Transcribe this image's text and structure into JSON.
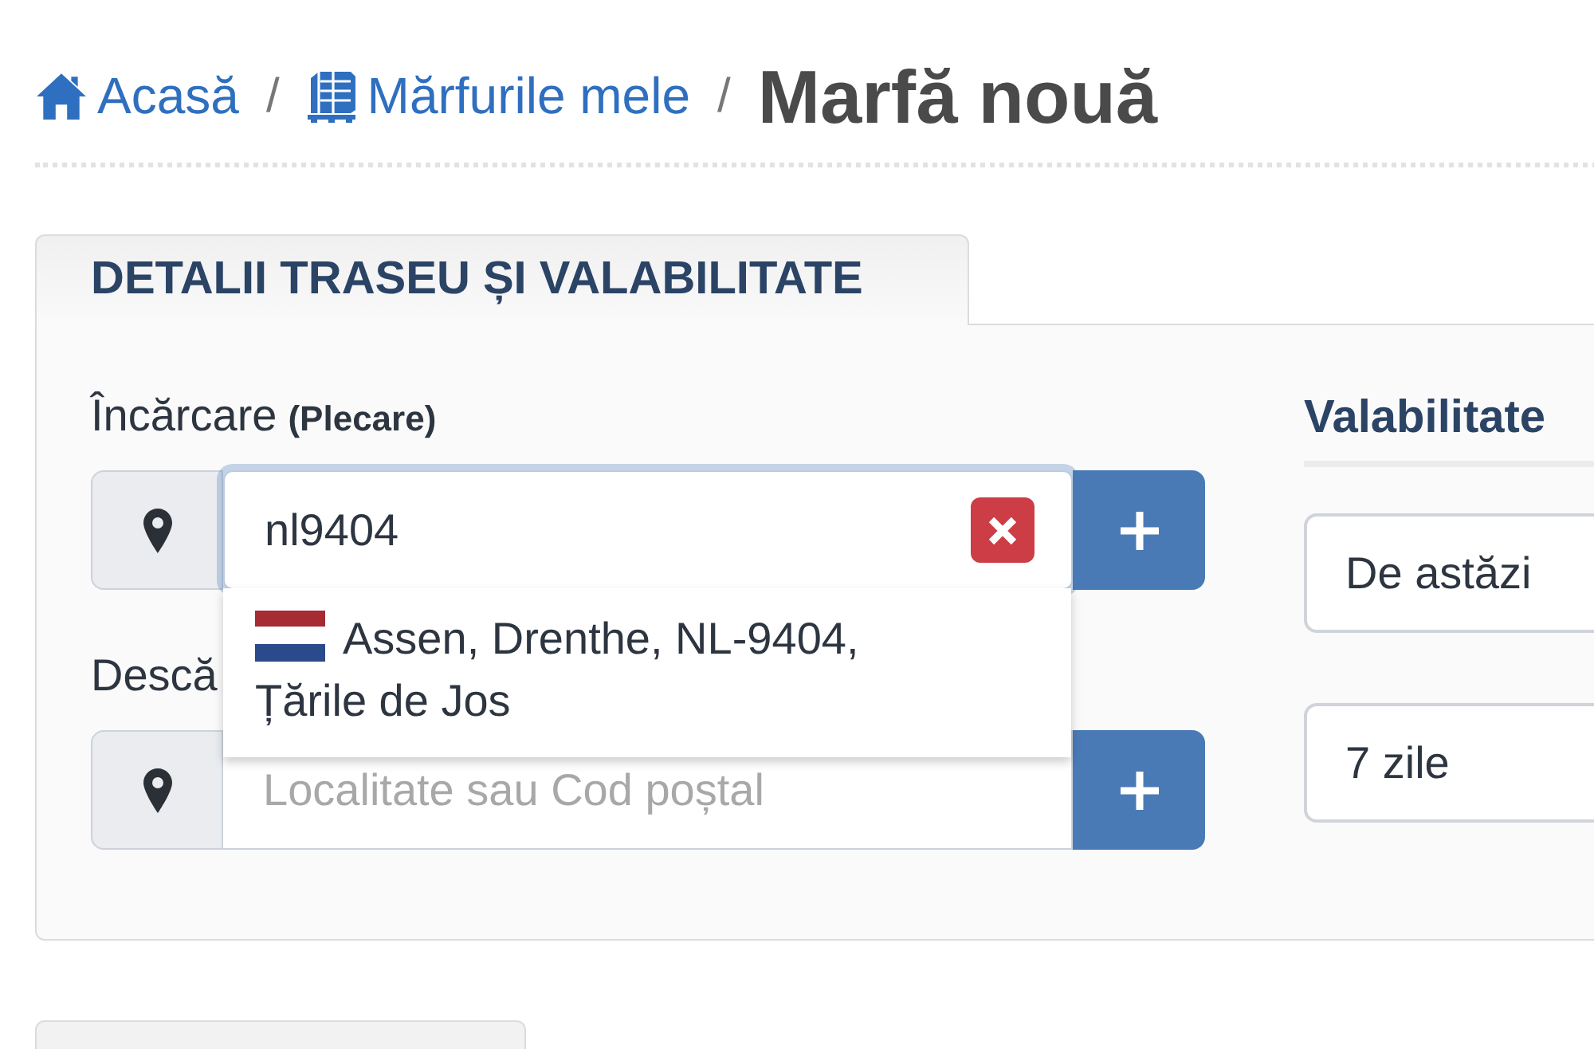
{
  "breadcrumb": {
    "links": [
      {
        "kind": "home",
        "label": "Acasă",
        "separator": "/"
      },
      {
        "kind": "goods",
        "label": "Mărfurile mele",
        "separator": "/"
      }
    ],
    "current": "Marfă nouă"
  },
  "panel": {
    "tab": "DETALII TRASEU ȘI VALABILITATE",
    "route": [
      {
        "label": "Încărcare",
        "note": "(Plecare)",
        "value": "nl9404",
        "focused": true,
        "suggestions": [
          {
            "text": "Assen, Drenthe, NL-9404, Țările de Jos"
          }
        ]
      },
      {
        "label": "Descă",
        "placeholder": "Localitate sau Cod poștal",
        "focused": false
      }
    ],
    "validity": {
      "title": "Valabilitate",
      "fields": [
        {
          "value": "De astăzi"
        },
        {
          "value": "7 zile"
        }
      ]
    }
  }
}
